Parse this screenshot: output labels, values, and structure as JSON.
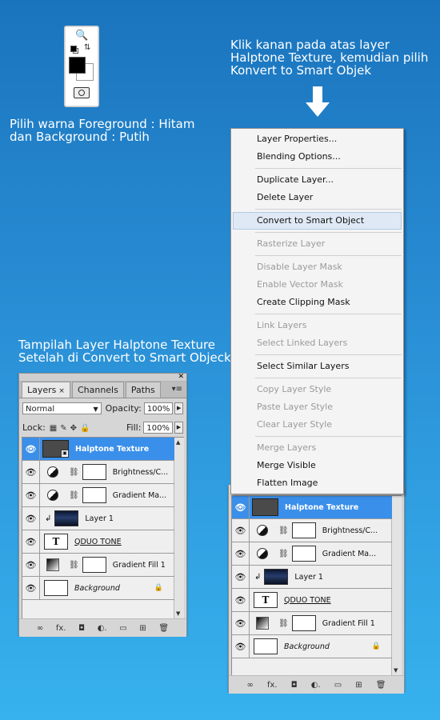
{
  "captions": {
    "right_instruction": [
      "Klik kanan pada atas layer",
      "Halptone Texture, kemudian pilih",
      "Konvert to Smart Objek"
    ],
    "left_instruction": [
      "Pilih warna Foreground : Hitam",
      "dan Background : Putih"
    ],
    "left_result": [
      "Tampilah Layer Halptone Texture",
      "Setelah di Convert to Smart Objeck"
    ]
  },
  "colors": {
    "foreground": "#000000",
    "background": "#ffffff",
    "selection": "#3a8fea"
  },
  "toolbox": {
    "icons": [
      "zoom-icon",
      "default-colors-icon",
      "swap-colors-icon",
      "quick-mask-icon"
    ]
  },
  "layers_panel": {
    "tabs": [
      "Layers",
      "Channels",
      "Paths"
    ],
    "tab_close": "×",
    "blend_mode": "Normal",
    "opacity_label": "Opacity:",
    "opacity": "100%",
    "lock_label": "Lock:",
    "fill_label": "Fill:",
    "fill": "100%",
    "layers": [
      {
        "name": "Halptone Texture",
        "type": "smart-object",
        "selected": true
      },
      {
        "name": "Brightness/C...",
        "type": "adjustment"
      },
      {
        "name": "Gradient Ma...",
        "type": "adjustment"
      },
      {
        "name": "Layer 1",
        "type": "image",
        "clipped": true
      },
      {
        "name": "QDUO TONE",
        "type": "text",
        "thumb_label": "T"
      },
      {
        "name": "Gradient Fill 1",
        "type": "gradient-fill"
      },
      {
        "name": "Background",
        "type": "background",
        "locked": true
      }
    ],
    "bottom_icons": [
      "link-layers-icon",
      "layer-style-icon",
      "add-mask-icon",
      "adjustment-layer-icon",
      "new-group-icon",
      "new-layer-icon",
      "delete-layer-icon"
    ],
    "bottom_labels": [
      "∞",
      "fx.",
      "◘",
      "◐.",
      "▭",
      "⊞",
      "🗑"
    ]
  },
  "context_menu": {
    "items": [
      {
        "label": "Layer Properties...",
        "enabled": true
      },
      {
        "label": "Blending Options...",
        "enabled": true
      },
      {
        "sep": true
      },
      {
        "label": "Duplicate Layer...",
        "enabled": true
      },
      {
        "label": "Delete Layer",
        "enabled": true
      },
      {
        "sep": true
      },
      {
        "label": "Convert to Smart Object",
        "enabled": true,
        "highlighted": true
      },
      {
        "sep": true
      },
      {
        "label": "Rasterize Layer",
        "enabled": false
      },
      {
        "sep": true
      },
      {
        "label": "Disable Layer Mask",
        "enabled": false
      },
      {
        "label": "Enable Vector Mask",
        "enabled": false
      },
      {
        "label": "Create Clipping Mask",
        "enabled": true
      },
      {
        "sep": true
      },
      {
        "label": "Link Layers",
        "enabled": false
      },
      {
        "label": "Select Linked Layers",
        "enabled": false
      },
      {
        "sep": true
      },
      {
        "label": "Select Similar Layers",
        "enabled": true
      },
      {
        "sep": true
      },
      {
        "label": "Copy Layer Style",
        "enabled": false
      },
      {
        "label": "Paste Layer Style",
        "enabled": false
      },
      {
        "label": "Clear Layer Style",
        "enabled": false
      },
      {
        "sep": true
      },
      {
        "label": "Merge Layers",
        "enabled": false
      },
      {
        "label": "Merge Visible",
        "enabled": true
      },
      {
        "label": "Flatten Image",
        "enabled": true
      }
    ]
  }
}
